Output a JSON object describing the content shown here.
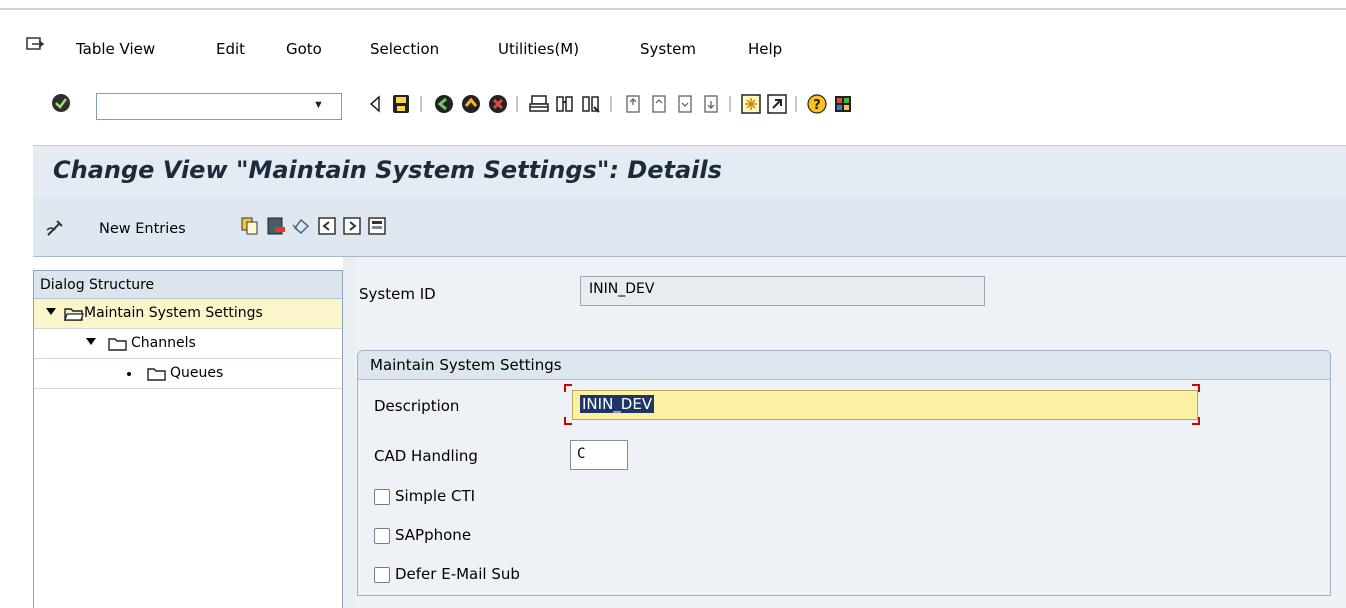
{
  "menu": [
    "Table View",
    "Edit",
    "Goto",
    "Selection",
    "Utilities(M)",
    "System",
    "Help"
  ],
  "toolbar": {
    "command_field_value": "",
    "icons": [
      "enter-icon",
      "back-icon",
      "save-icon",
      "back-nav-icon",
      "exit-icon",
      "cancel-icon",
      "print-icon",
      "find-icon",
      "find-next-icon",
      "first-page-icon",
      "previous-page-icon",
      "next-page-icon",
      "last-page-icon",
      "create-session-icon",
      "shortcut-icon",
      "help-icon",
      "customize-layout-icon"
    ]
  },
  "title": "Change View \"Maintain System Settings\": Details",
  "app_toolbar": {
    "new_entries": "New Entries",
    "icons": [
      "display-change-icon",
      "copy-icon",
      "delete-icon",
      "undo-icon",
      "previous-entry-icon",
      "next-entry-icon",
      "select-all-icon"
    ]
  },
  "dialog_structure": {
    "header": "Dialog Structure",
    "items": [
      {
        "label": "Maintain System Settings",
        "level": 0,
        "expanded": true,
        "selected": true
      },
      {
        "label": "Channels",
        "level": 1,
        "expanded": true,
        "selected": false
      },
      {
        "label": "Queues",
        "level": 2,
        "expanded": false,
        "selected": false
      }
    ]
  },
  "form": {
    "system_id_label": "System ID",
    "system_id_value": "ININ_DEV",
    "group_title": "Maintain System Settings",
    "description_label": "Description",
    "description_value": "ININ_DEV",
    "cad_label": "CAD Handling",
    "cad_value": "C",
    "checkboxes": [
      {
        "label": "Simple CTI",
        "checked": false
      },
      {
        "label": "SAPphone",
        "checked": false
      },
      {
        "label": "Defer E-Mail Sub",
        "checked": false
      }
    ]
  },
  "colors": {
    "title_band": "#e4ebf3",
    "tree_selected": "#fbf6c9",
    "focus_field": "#fcf1a3",
    "selection": "#1d3667"
  }
}
